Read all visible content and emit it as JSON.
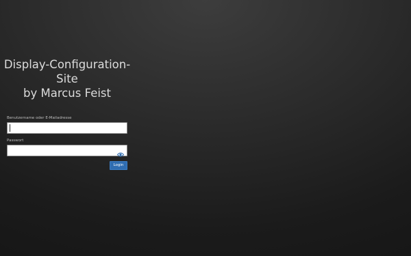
{
  "title": {
    "line1": "Display-Configuration-",
    "line2": "Site",
    "line3": "by Marcus Feist"
  },
  "form": {
    "username_label": "Benutzername oder E-Mailadresse",
    "username_value": "",
    "password_label": "Passwort",
    "password_value": "",
    "password_toggle_icon": "eye-icon",
    "login_label": "Login"
  },
  "colors": {
    "accent": "#2f6db1",
    "background": "#1b1b1b",
    "eye_icon": "#2f6db1"
  }
}
